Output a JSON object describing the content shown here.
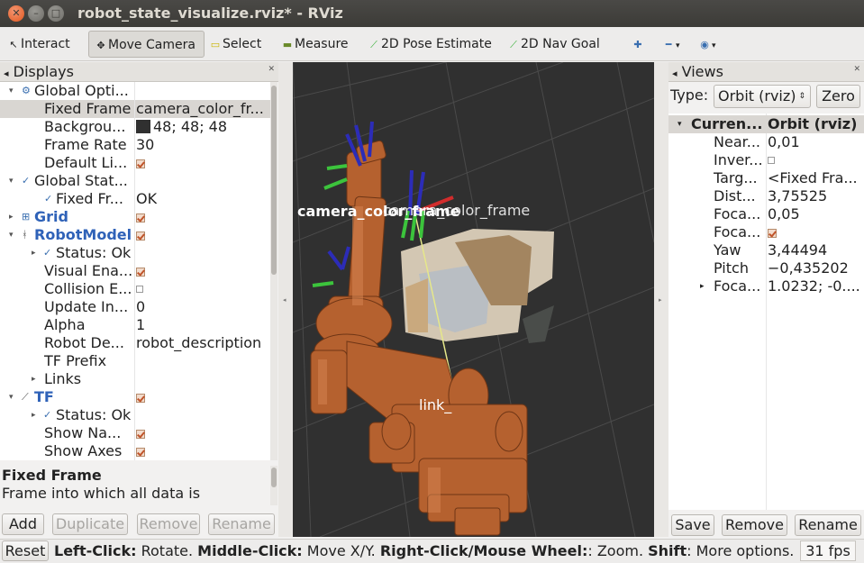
{
  "window": {
    "title": "robot_state_visualize.rviz* - RViz"
  },
  "toolbar": {
    "interact": "Interact",
    "move_camera": "Move Camera",
    "select": "Select",
    "measure": "Measure",
    "pose_estimate": "2D Pose Estimate",
    "nav_goal": "2D Nav Goal"
  },
  "displays": {
    "title": "Displays",
    "rows": [
      {
        "label": "Global Opti...",
        "value": ""
      },
      {
        "label": "Fixed Frame",
        "value": "camera_color_fr..."
      },
      {
        "label": "Backgrou...",
        "value": "48; 48; 48"
      },
      {
        "label": "Frame Rate",
        "value": "30"
      },
      {
        "label": "Default Li...",
        "value": ""
      },
      {
        "label": "Global Stat...",
        "value": ""
      },
      {
        "label": "Fixed Fr...",
        "value": "OK"
      },
      {
        "label": "Grid",
        "value": ""
      },
      {
        "label": "RobotModel",
        "value": ""
      },
      {
        "label": "Status: Ok",
        "value": ""
      },
      {
        "label": "Visual Ena...",
        "value": ""
      },
      {
        "label": "Collision E...",
        "value": ""
      },
      {
        "label": "Update In...",
        "value": "0"
      },
      {
        "label": "Alpha",
        "value": "1"
      },
      {
        "label": "Robot De...",
        "value": "robot_description"
      },
      {
        "label": "TF Prefix",
        "value": ""
      },
      {
        "label": "Links",
        "value": ""
      },
      {
        "label": "TF",
        "value": ""
      },
      {
        "label": "Status: Ok",
        "value": ""
      },
      {
        "label": "Show Na...",
        "value": ""
      },
      {
        "label": "Show Axes",
        "value": ""
      }
    ],
    "description_title": "Fixed Frame",
    "description_text": "Frame into which all data is",
    "buttons": {
      "add": "Add",
      "duplicate": "Duplicate",
      "remove": "Remove",
      "rename": "Rename"
    }
  },
  "scene": {
    "frame_labels": [
      "camera_color_frame",
      "link_"
    ],
    "background_color": "#303030",
    "robot_color": "#b5612f"
  },
  "views": {
    "title": "Views",
    "type_label": "Type:",
    "type_value": "Orbit (rviz)",
    "zero": "Zero",
    "header": {
      "label": "Curren...",
      "value": "Orbit (rviz)"
    },
    "rows": [
      {
        "label": "Near...",
        "value": "0,01"
      },
      {
        "label": "Inver...",
        "value": ""
      },
      {
        "label": "Targ...",
        "value": "<Fixed Fra..."
      },
      {
        "label": "Dist...",
        "value": "3,75525"
      },
      {
        "label": "Foca...",
        "value": "0,05"
      },
      {
        "label": "Foca...",
        "value": ""
      },
      {
        "label": "Yaw",
        "value": "3,44494"
      },
      {
        "label": "Pitch",
        "value": "−0,435202"
      },
      {
        "label": "Foca...",
        "value": "1.0232; -0...."
      }
    ],
    "buttons": {
      "save": "Save",
      "remove": "Remove",
      "rename": "Rename"
    }
  },
  "status": {
    "left_click_key": "Left-Click:",
    "left_click_desc": " Rotate. ",
    "middle_click_key": "Middle-Click:",
    "middle_click_desc": " Move X/Y. ",
    "right_click_key": "Right-Click/Mouse Wheel:",
    "right_click_desc": ": Zoom. ",
    "shift_key": "Shift",
    "shift_desc": ": More options.",
    "reset": "Reset",
    "fps": "31 fps"
  }
}
